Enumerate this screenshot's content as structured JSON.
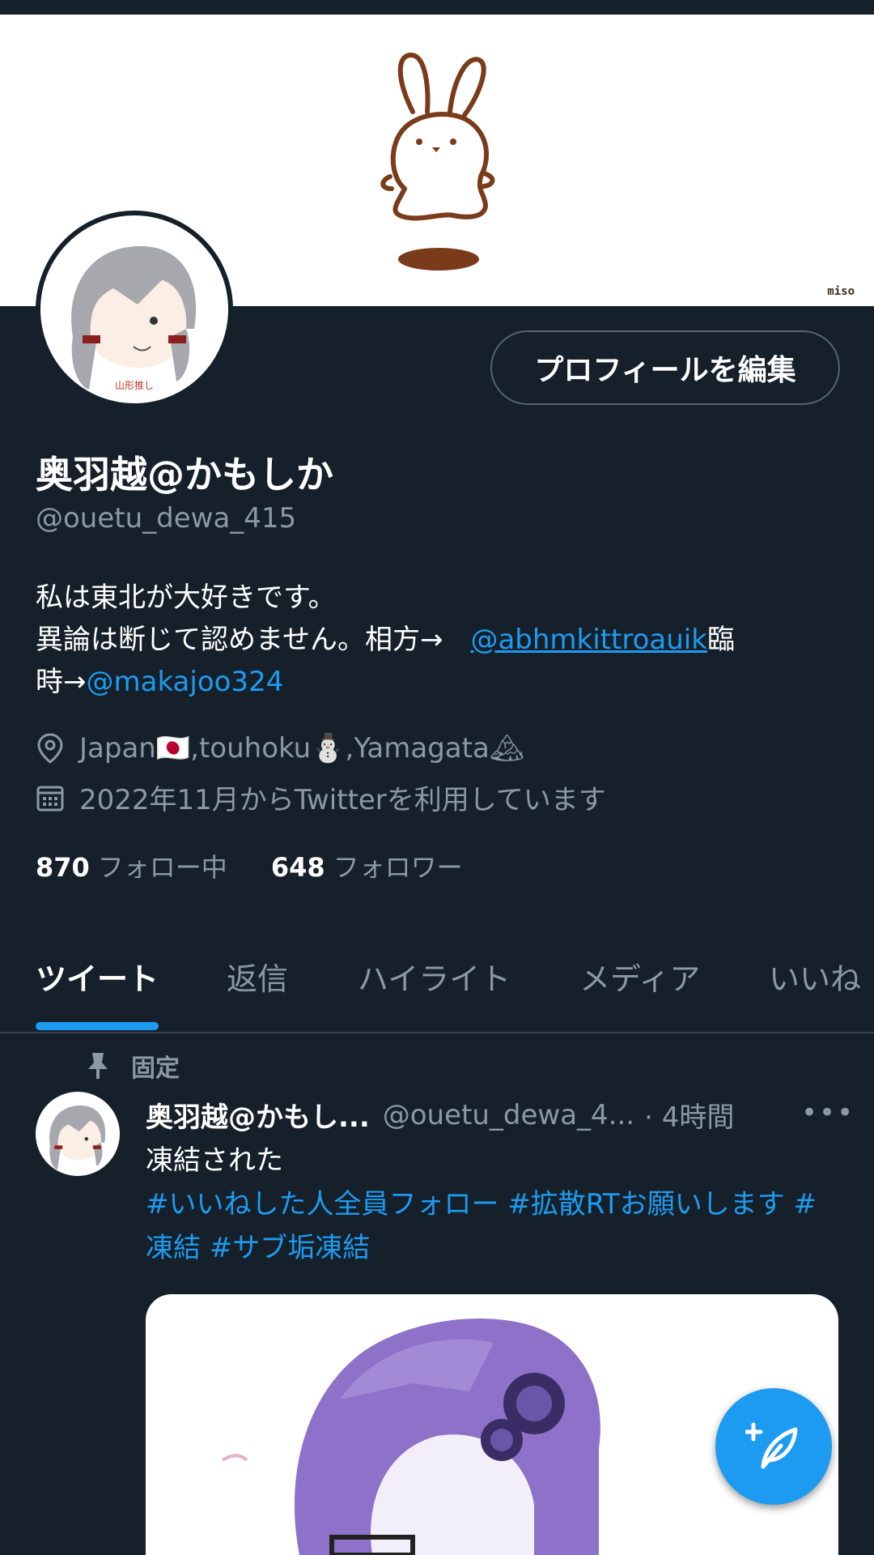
{
  "banner": {
    "signature": "miso"
  },
  "profile": {
    "avatar_label": "山形推し",
    "edit_button": "プロフィールを編集",
    "name": "奥羽越@かもしか",
    "handle": "@ouetu_dewa_415",
    "bio_line1": "私は東北が大好きです。",
    "bio_line2_prefix": "異論は断じて認めません。相方→　",
    "bio_mention1": "@abhmkittroauik",
    "bio_line2_suffix": "臨",
    "bio_line3_prefix": "時→",
    "bio_mention2": "@makajoo324",
    "location": "Japan🇯🇵,touhoku⛄,Yamagata🏔",
    "joined": "2022年11月からTwitterを利用しています",
    "following_count": "870",
    "following_label": "フォロー中",
    "followers_count": "648",
    "followers_label": "フォロワー"
  },
  "tabs": [
    {
      "label": "ツイート",
      "active": true
    },
    {
      "label": "返信"
    },
    {
      "label": "ハイライト"
    },
    {
      "label": "メディア"
    },
    {
      "label": "いいね"
    }
  ],
  "tweet": {
    "pinned_label": "固定",
    "name": "奥羽越@かもし...",
    "handle": "@ouetu_dewa_4...",
    "time": "· 4時間",
    "more": "•••",
    "text": "凍結された",
    "hashtags": "#いいねした人全員フォロー #拡散RTお願いします #凍結 #サブ垢凍結"
  },
  "colors": {
    "background": "#15202b",
    "accent": "#1d9bf0",
    "secondary_text": "#8b98a5"
  },
  "icons": {
    "location": "location-pin-icon",
    "calendar": "calendar-icon",
    "pin": "pin-icon",
    "compose": "compose-tweet-icon"
  }
}
